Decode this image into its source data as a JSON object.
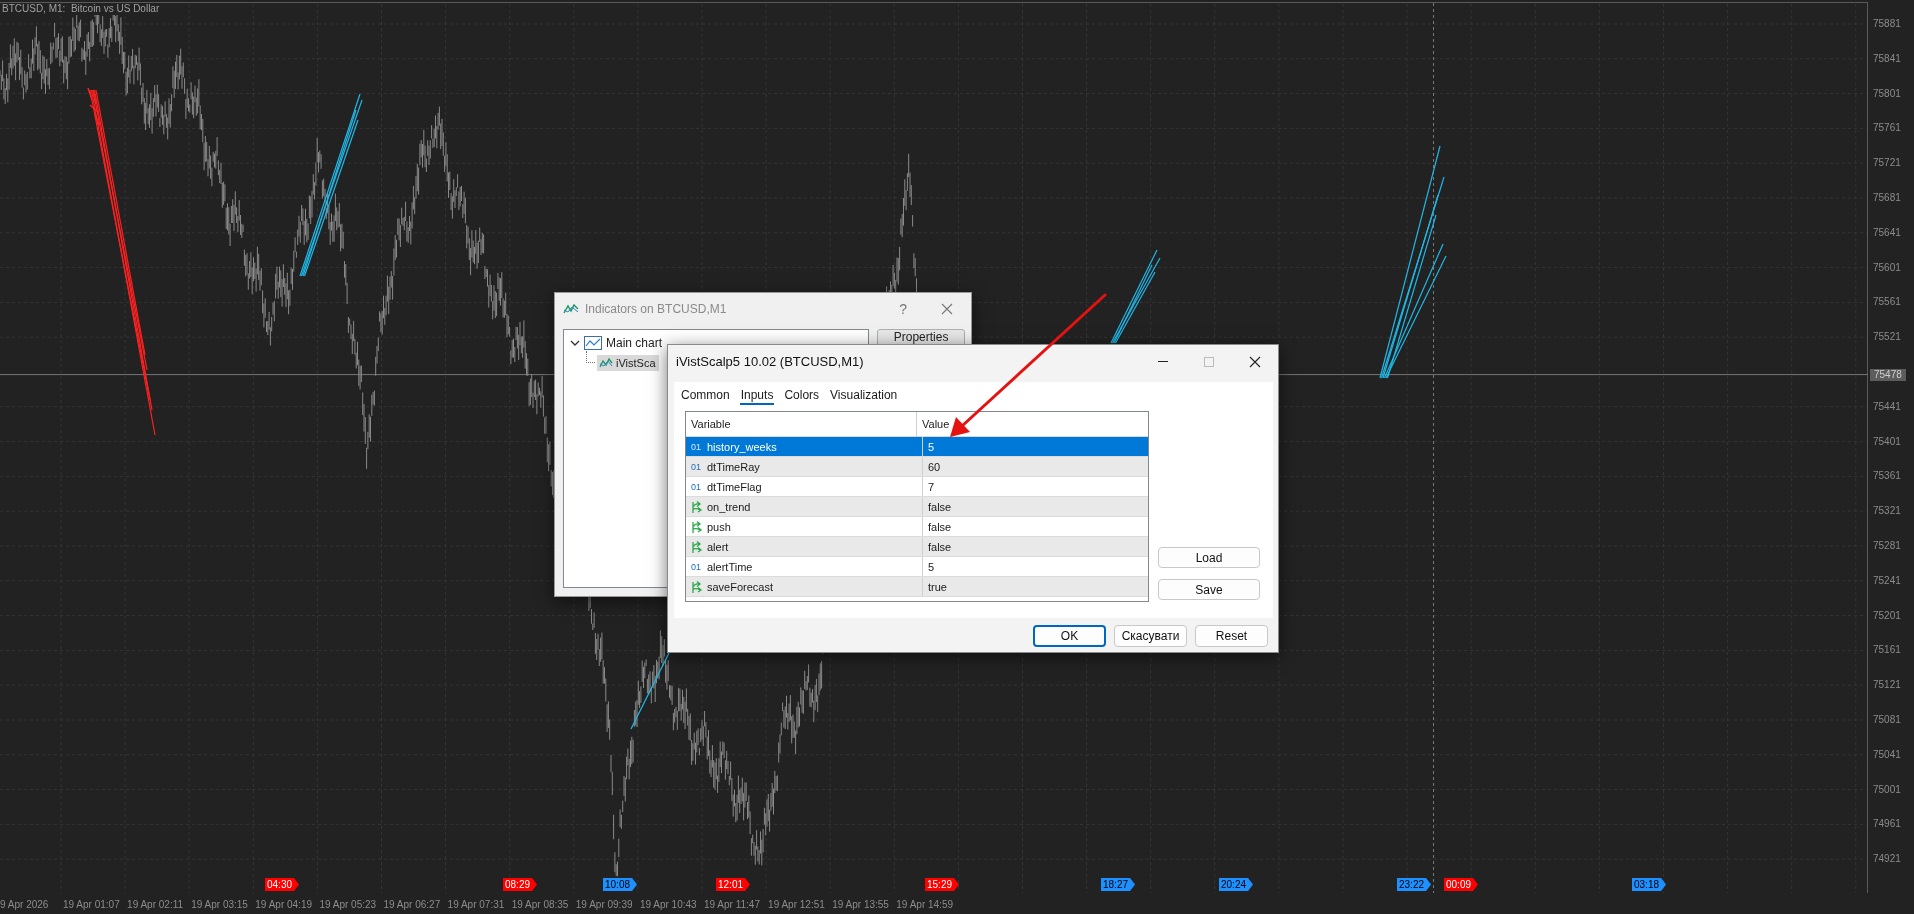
{
  "chart": {
    "title": "BTCUSD, M1:  Bitcoin vs US Dollar",
    "price_axis": {
      "labels": [
        "75881",
        "75841",
        "75801",
        "75761",
        "75721",
        "75681",
        "75641",
        "75601",
        "75561",
        "75521",
        "75441",
        "75401",
        "75361",
        "75321",
        "75281",
        "75241",
        "75201",
        "75161",
        "75121",
        "75081",
        "75041",
        "75001",
        "74961",
        "74921"
      ],
      "current_price": "75478"
    },
    "time_axis": {
      "labels": [
        "9 Apr 2026",
        "19 Apr 01:07",
        "19 Apr 02:11",
        "19 Apr 03:15",
        "19 Apr 04:19",
        "19 Apr 05:23",
        "19 Apr 06:27",
        "19 Apr 07:31",
        "19 Apr 08:35",
        "19 Apr 09:39",
        "19 Apr 10:43",
        "19 Apr 11:47",
        "19 Apr 12:51",
        "19 Apr 13:55",
        "19 Apr 14:59"
      ]
    },
    "time_flags": [
      {
        "label": "04:30",
        "color": "#ff0000"
      },
      {
        "label": "08:29",
        "color": "#ff0000"
      },
      {
        "label": "10:08",
        "color": "#1e90ff"
      },
      {
        "label": "12:01",
        "color": "#ff0000"
      },
      {
        "label": "15:29",
        "color": "#ff0000"
      },
      {
        "label": "18:27",
        "color": "#1e90ff"
      },
      {
        "label": "20:24",
        "color": "#1e90ff"
      },
      {
        "label": "23:22",
        "color": "#1e90ff"
      },
      {
        "label": "00:09",
        "color": "#ff0000"
      },
      {
        "label": "03:18",
        "color": "#1e90ff"
      }
    ]
  },
  "indicators_dialog": {
    "title": "Indicators on BTCUSD,M1",
    "help": "?",
    "tree": [
      {
        "label": "Main chart",
        "expanded": true,
        "children": [
          {
            "label": "iVistSca",
            "selected": true
          }
        ]
      }
    ],
    "button": "Properties"
  },
  "properties_dialog": {
    "title": "iVistScalp5 10.02 (BTCUSD,M1)",
    "tabs": [
      {
        "label": "Common",
        "selected": false
      },
      {
        "label": "Inputs",
        "selected": true
      },
      {
        "label": "Colors",
        "selected": false
      },
      {
        "label": "Visualization",
        "selected": false
      }
    ],
    "table": {
      "columns": [
        "Variable",
        "Value"
      ],
      "rows": [
        {
          "kind": "int",
          "type_label": "01",
          "variable": "history_weeks",
          "value": "5",
          "selected": true
        },
        {
          "kind": "int",
          "type_label": "01",
          "variable": "dtTimeRay",
          "value": "60",
          "selected": false
        },
        {
          "kind": "int",
          "type_label": "01",
          "variable": "dtTimeFlag",
          "value": "7",
          "selected": false
        },
        {
          "kind": "bool",
          "variable": "on_trend",
          "value": "false",
          "selected": false
        },
        {
          "kind": "bool",
          "variable": "push",
          "value": "false",
          "selected": false
        },
        {
          "kind": "bool",
          "variable": "alert",
          "value": "false",
          "selected": false
        },
        {
          "kind": "int",
          "type_label": "01",
          "variable": "alertTime",
          "value": "5",
          "selected": false
        },
        {
          "kind": "bool",
          "variable": "saveForecast",
          "value": "true",
          "selected": false
        }
      ]
    },
    "side_buttons": [
      "Load",
      "Save"
    ],
    "buttons": [
      {
        "label": "OK",
        "default": true
      },
      {
        "label": "Скасувати",
        "default": false
      },
      {
        "label": "Reset",
        "default": false
      }
    ]
  }
}
